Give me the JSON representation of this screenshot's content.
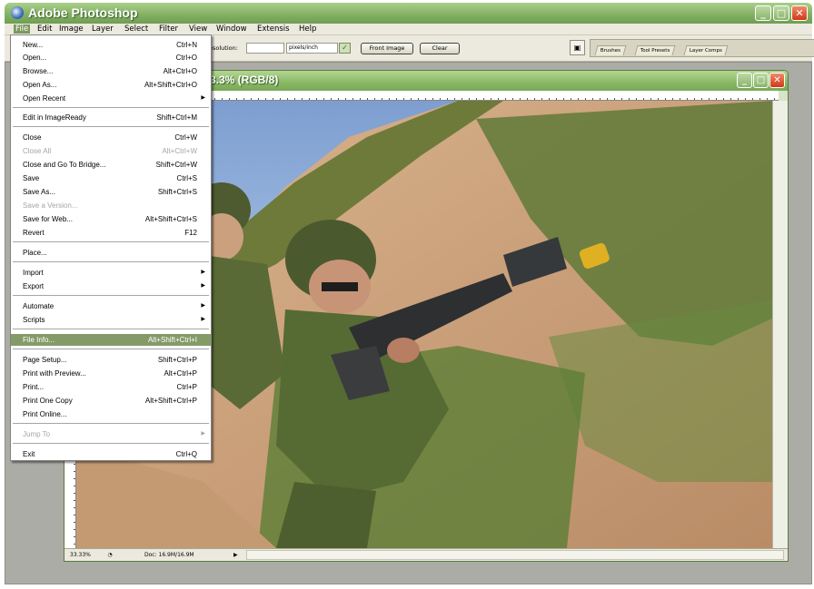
{
  "app": {
    "title": "Adobe Photoshop"
  },
  "window_controls": {
    "minimize": "_",
    "maximize": "□",
    "close": "✕"
  },
  "menubar": [
    "File",
    "Edit",
    "Image",
    "Layer",
    "Select",
    "Filter",
    "View",
    "Window",
    "Extensis",
    "Help"
  ],
  "options": {
    "resolution_label": "esolution:",
    "resolution_value": "",
    "units": "pixels/inch",
    "front_image": "Front Image",
    "clear": "Clear"
  },
  "palette_well": {
    "tabs": [
      "Brushes",
      "Tool Presets",
      "Layer Comps"
    ]
  },
  "document": {
    "title": "3.3% (RGB/8)"
  },
  "status": {
    "zoom": "33.33%",
    "doc_info": "Doc: 16.9M/16.9M"
  },
  "file_menu": [
    {
      "label": "New...",
      "shortcut": "Ctrl+N"
    },
    {
      "label": "Open...",
      "shortcut": "Ctrl+O"
    },
    {
      "label": "Browse...",
      "shortcut": "Alt+Ctrl+O"
    },
    {
      "label": "Open As...",
      "shortcut": "Alt+Shift+Ctrl+O"
    },
    {
      "label": "Open Recent",
      "shortcut": "",
      "arrow": "▶"
    },
    {
      "label": "Edit in ImageReady",
      "shortcut": "Shift+Ctrl+M"
    },
    {
      "label": "Close",
      "shortcut": "Ctrl+W"
    },
    {
      "label": "Close All",
      "shortcut": "Alt+Ctrl+W",
      "disabled": true
    },
    {
      "label": "Close and Go To Bridge...",
      "shortcut": "Shift+Ctrl+W"
    },
    {
      "label": "Save",
      "shortcut": "Ctrl+S"
    },
    {
      "label": "Save As...",
      "shortcut": "Shift+Ctrl+S"
    },
    {
      "label": "Save a Version...",
      "shortcut": "",
      "disabled": true
    },
    {
      "label": "Save for Web...",
      "shortcut": "Alt+Shift+Ctrl+S"
    },
    {
      "label": "Revert",
      "shortcut": "F12"
    },
    {
      "label": "Place...",
      "shortcut": ""
    },
    {
      "label": "Import",
      "shortcut": "",
      "arrow": "▶"
    },
    {
      "label": "Export",
      "shortcut": "",
      "arrow": "▶"
    },
    {
      "label": "Automate",
      "shortcut": "",
      "arrow": "▶"
    },
    {
      "label": "Scripts",
      "shortcut": "",
      "arrow": "▶"
    },
    {
      "label": "File Info...",
      "shortcut": "Alt+Shift+Ctrl+I",
      "highlighted": true
    },
    {
      "label": "Page Setup...",
      "shortcut": "Shift+Ctrl+P"
    },
    {
      "label": "Print with Preview...",
      "shortcut": "Alt+Ctrl+P"
    },
    {
      "label": "Print...",
      "shortcut": "Ctrl+P"
    },
    {
      "label": "Print One Copy",
      "shortcut": "Alt+Shift+Ctrl+P"
    },
    {
      "label": "Print Online...",
      "shortcut": ""
    },
    {
      "label": "Jump To",
      "shortcut": "",
      "arrow": "▶",
      "disabled": true
    },
    {
      "label": "Exit",
      "shortcut": "Ctrl+Q"
    }
  ],
  "colors": {
    "xp_green": "#84b264",
    "menu_highlight": "#849b68",
    "workspace": "#abaca6"
  }
}
